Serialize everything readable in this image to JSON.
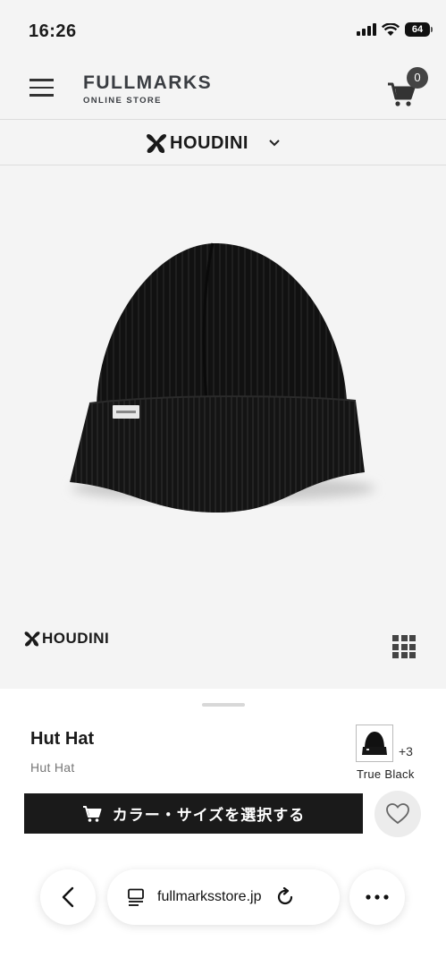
{
  "status_bar": {
    "time": "16:26",
    "battery": "64"
  },
  "header": {
    "brand": "FULLMARKS",
    "sub": "ONLINE STORE",
    "cart_count": "0"
  },
  "brand_selector": {
    "name": "HOUDINI"
  },
  "hero": {
    "brand": "HOUDINI"
  },
  "product": {
    "name": "Hut Hat",
    "subtitle": "Hut Hat",
    "extra_colors": "+3",
    "color_name": "True Black",
    "cta_label": "カラー・サイズを選択する"
  },
  "browser": {
    "url": "fullmarksstore.jp"
  },
  "icons": [
    "hamburger-icon",
    "cart-icon",
    "houdini-logo-icon",
    "chevron-down-icon",
    "grid-icon",
    "heart-icon",
    "back-icon",
    "page-icon",
    "reload-icon",
    "more-icon"
  ],
  "colors": {
    "background": "#f4f4f4",
    "cta": "#1a1a1a",
    "badge": "#444444"
  }
}
